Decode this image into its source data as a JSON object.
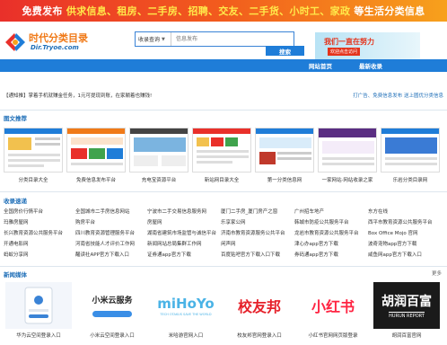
{
  "banner": {
    "part1": "免费发布 ",
    "part2": "供求信息、租房、二手房、招聘、交友、二手货、小时工、家政",
    "part3": " 等生活分类信息"
  },
  "logo": {
    "title": "时代分类目录",
    "url": "Dir.Tryoe.com"
  },
  "search": {
    "select_label": "收录查询",
    "placeholder": "信息发布",
    "button": "搜索"
  },
  "ad": {
    "text": "我们一直在努力",
    "sub": "欢迎点击访问",
    "accent": "#e4341c"
  },
  "nav": {
    "items": [
      "网站首页",
      "最新收录"
    ]
  },
  "notice": {
    "left": "【通知推】掌着手机就赚金任务，1元可提现到账，在家躺着也赚钱!",
    "right": "打广告、免费信息发布 送上圆优分类信息"
  },
  "sections": {
    "pictures": "图文推荐",
    "links": "收录速递",
    "media": "新闻媒体",
    "more": "更多"
  },
  "pictures": [
    {
      "caption": "分类目录大全"
    },
    {
      "caption": "免费信息发布平台"
    },
    {
      "caption": "充电宝资源平台"
    },
    {
      "caption": "新站网目录大全"
    },
    {
      "caption": "第一分类信息网"
    },
    {
      "caption": "一家网站·网站收录之家"
    },
    {
      "caption": "乐岩分类目录网"
    }
  ],
  "links": [
    [
      "全国房价行情平台",
      "全国城市二手房信息网站",
      "宁波市二手交易信息服务网",
      "厦门二手房_厦门房产之窗",
      "广州招车地产",
      "东方在线"
    ],
    [
      "玛雅房屋网",
      "购房平台",
      "房屋网",
      "乐享家公网",
      "韩城市防疫公共服务平台",
      "西平市教育资源公共服务平台"
    ],
    [
      "长兴教育资源公共服务平台",
      "四川教育资源管理服务平台",
      "湖南省建筑市场监管与诚信平台",
      "济南市教育资源服务公共平台",
      "龙岩市教育资源公共服务平台",
      "Box Office Mojo 官网"
    ],
    [
      "开通电影网",
      "河南省技能人才评价工作网",
      "新闻网站总局集群工作网",
      "闲声网",
      "津心办app官方下载",
      "波奇宠物app官方下载"
    ],
    [
      "蚂蚁分享网",
      "醒读社APP官方下载入口",
      "证券通app官方下载",
      "百度贴吧官方下载入口下载",
      "券码通app官方下载",
      "咸鱼网app官方下载入口"
    ]
  ],
  "media": [
    {
      "caption": "华为云空间登录入口",
      "brand": ""
    },
    {
      "caption": "小米云空间登录入口",
      "brand": "小米云服务"
    },
    {
      "caption": "米哈游官网入口",
      "brand": "miHoYo",
      "tagline": "TECH OTAKUS SAVE THE WORLD"
    },
    {
      "caption": "校友邦官网登录入口",
      "brand": "校友邦"
    },
    {
      "caption": "小红书官网网页版登录",
      "brand": "小红书"
    },
    {
      "caption": "胡润百富官网",
      "brand": "胡润百富",
      "tagline": "HURUN REPORT"
    }
  ],
  "colors": {
    "brand_blue": "#1f7dd8",
    "banner_red": "#e9302a",
    "banner_yellow": "#ffe94a",
    "xiaohongshu_red": "#ff2442",
    "xiaoyoubang_red": "#e6212a"
  }
}
